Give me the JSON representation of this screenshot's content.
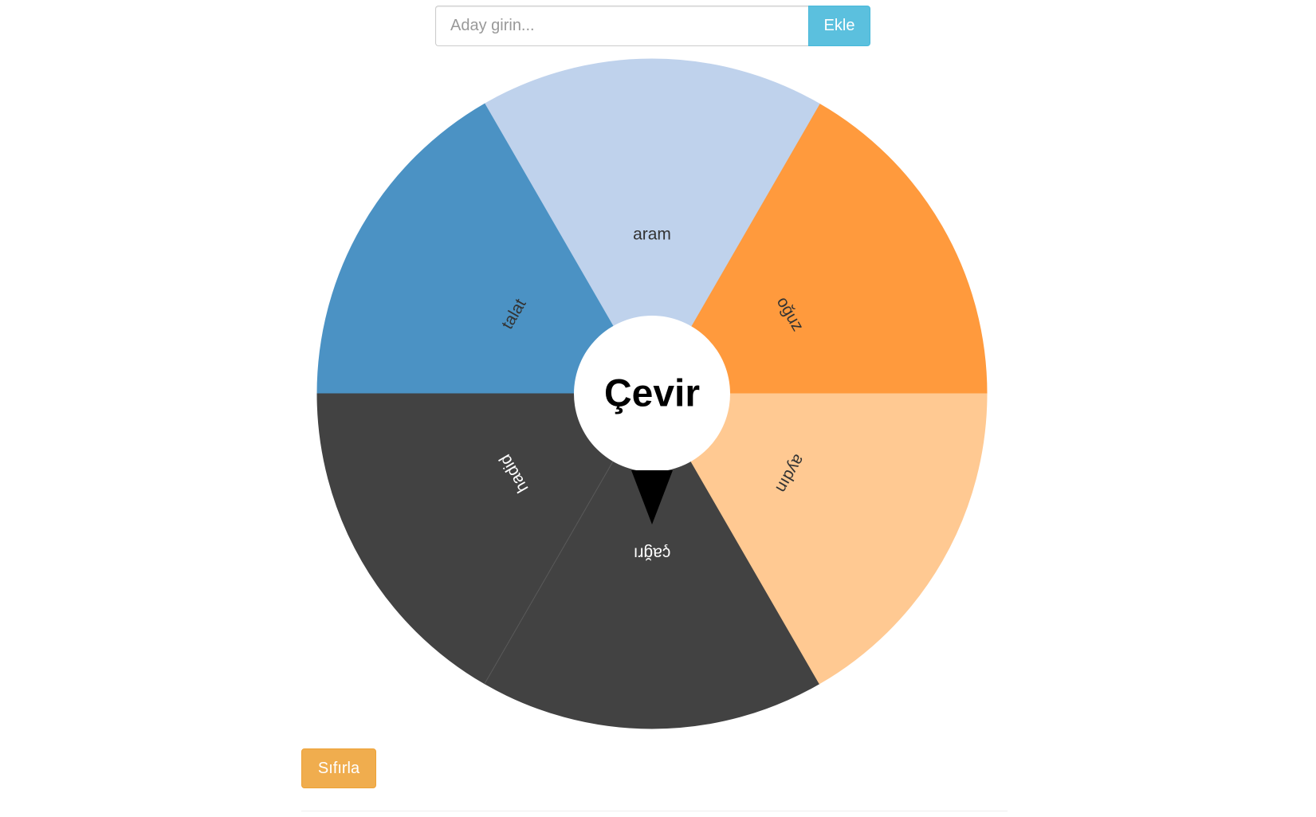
{
  "add_form": {
    "input_placeholder": "Aday girin...",
    "input_value": "",
    "add_label": "Ekle"
  },
  "wheel": {
    "spin_label": "Çevir",
    "segments": [
      {
        "label": "oğuz",
        "color": "#ff9a3d",
        "text_color": "#333333"
      },
      {
        "label": "aram",
        "color": "#bfd2ec",
        "text_color": "#333333"
      },
      {
        "label": "talat",
        "color": "#4b92c4",
        "text_color": "#333333"
      },
      {
        "label": "hadid",
        "color": "#424242",
        "text_color": "#ffffff"
      },
      {
        "label": "çağrı",
        "color": "#424242",
        "text_color": "#ffffff"
      },
      {
        "label": "aydın",
        "color": "#ffc992",
        "text_color": "#333333"
      }
    ],
    "pointer_color": "#000000"
  },
  "controls": {
    "reset_label": "Sıfırla"
  },
  "colors": {
    "info": "#5bc0de",
    "warning": "#f0ad4e"
  }
}
